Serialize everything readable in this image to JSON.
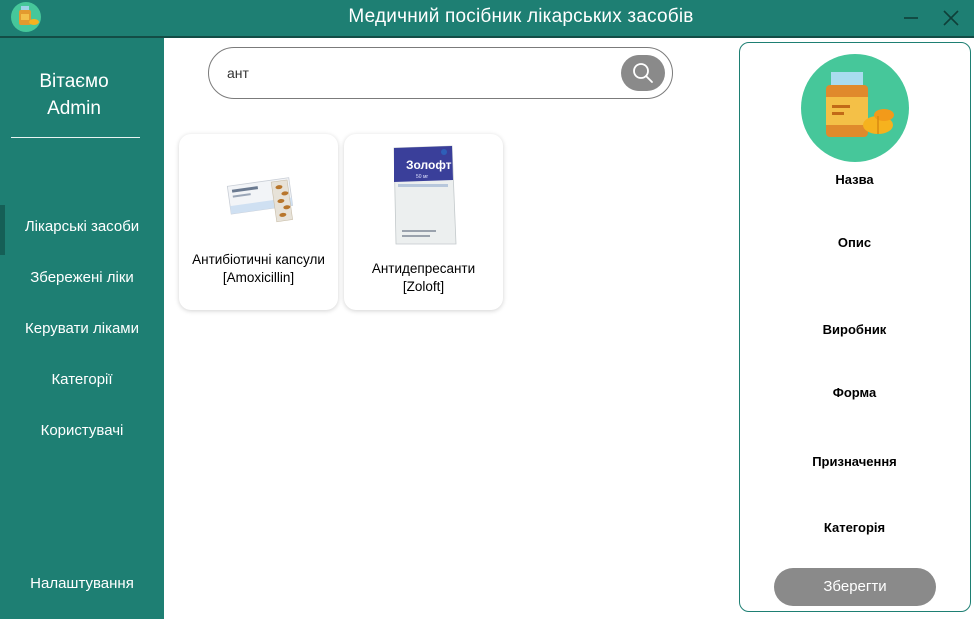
{
  "window": {
    "title": "Медичний посібник лікарських засобів",
    "controls": {
      "minimize_icon": "minimize-icon",
      "close_icon": "close-icon"
    }
  },
  "colors": {
    "primary": "#1e7f73",
    "button_gray": "#8a8a8a",
    "avatar_bg": "#46c79a"
  },
  "sidebar": {
    "welcome_line1": "Вітаємо",
    "welcome_line2": "Admin",
    "items": [
      {
        "label": "Лікарські засоби",
        "active": true
      },
      {
        "label": "Збережені ліки",
        "active": false
      },
      {
        "label": "Керувати ліками",
        "active": false
      },
      {
        "label": "Категорії",
        "active": false
      },
      {
        "label": "Користувачі",
        "active": false
      }
    ],
    "settings_label": "Налаштування"
  },
  "search": {
    "value": "ант",
    "icon": "search-icon"
  },
  "results": [
    {
      "line1": "Антибіотичні капсули",
      "line2": "[Amoxicillin]"
    },
    {
      "line1": "Антидепресанти [Zoloft]",
      "line2": "",
      "box_brand": "Золофт",
      "box_dose": "50 мг"
    }
  ],
  "detail": {
    "fields": [
      "Назва",
      "Опис",
      "Виробник",
      "Форма",
      "Призначення",
      "Категорія"
    ],
    "save_label": "Зберегти"
  }
}
